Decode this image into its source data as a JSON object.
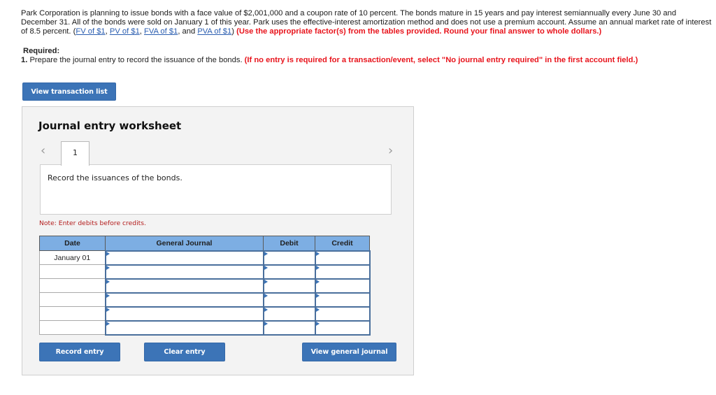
{
  "question": {
    "text_before_links": "Park Corporation is planning to issue bonds with a face value of $2,001,000 and a coupon rate of 10 percent. The bonds mature in 15 years and pay interest semiannually every June 30 and December 31. All of the bonds were sold on January 1 of this year. Park uses the effective-interest amortization method and does not use a premium account. Assume an annual market rate of interest of 8.5 percent. (",
    "links": [
      "FV of $1",
      "PV of $1",
      "FVA of $1",
      "PVA of $1"
    ],
    "sep1": ", ",
    "sep2": ", ",
    "sep3": ", and ",
    "after_links": ") ",
    "instruction": "(Use the appropriate factor(s) from the tables provided. Round your final answer to whole dollars.)"
  },
  "required": {
    "title": "Required:",
    "number": "1.",
    "text": " Prepare the journal entry to record the issuance of the bonds. ",
    "instruction": "(If no entry is required for a transaction/event, select \"No journal entry required\" in the first account field.)"
  },
  "buttons": {
    "view_transaction_list": "View transaction list",
    "record_entry": "Record entry",
    "clear_entry": "Clear entry",
    "view_general_journal": "View general journal"
  },
  "worksheet": {
    "title": "Journal entry worksheet",
    "prev_icon": "‹",
    "next_icon": "›",
    "active_tab": "1",
    "description": "Record the issuances of the bonds.",
    "note": "Note: Enter debits before credits.",
    "table": {
      "headers": [
        "Date",
        "General Journal",
        "Debit",
        "Credit"
      ],
      "rows": [
        {
          "date": "January 01",
          "account": "",
          "debit": "",
          "credit": ""
        },
        {
          "date": "",
          "account": "",
          "debit": "",
          "credit": ""
        },
        {
          "date": "",
          "account": "",
          "debit": "",
          "credit": ""
        },
        {
          "date": "",
          "account": "",
          "debit": "",
          "credit": ""
        },
        {
          "date": "",
          "account": "",
          "debit": "",
          "credit": ""
        },
        {
          "date": "",
          "account": "",
          "debit": "",
          "credit": ""
        }
      ]
    }
  },
  "colors": {
    "button_blue": "#3c74b7",
    "header_blue": "#7daee3",
    "instruction_red": "#e8141c",
    "note_red": "#b31b1b",
    "link_blue": "#2a5db0"
  }
}
